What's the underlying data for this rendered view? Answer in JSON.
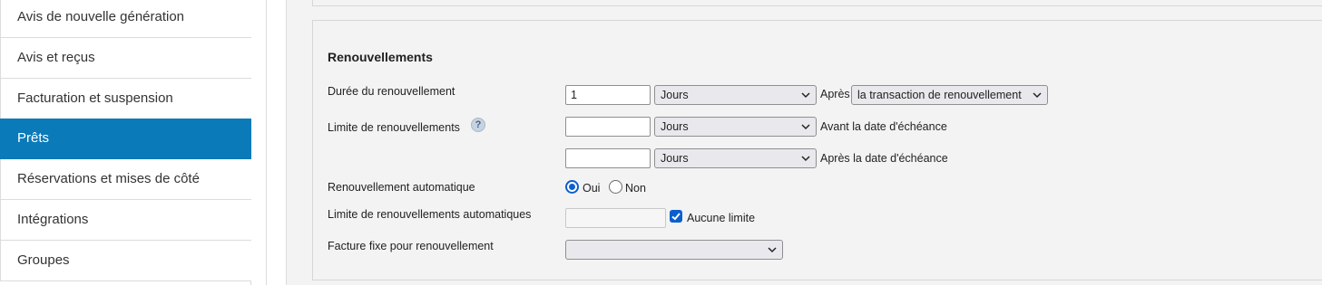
{
  "sidebar": {
    "items": [
      {
        "label": "Avis de nouvelle génération",
        "active": false
      },
      {
        "label": "Avis et reçus",
        "active": false
      },
      {
        "label": "Facturation et suspension",
        "active": false
      },
      {
        "label": "Prêts",
        "active": true
      },
      {
        "label": "Réservations et mises de côté",
        "active": false
      },
      {
        "label": "Intégrations",
        "active": false
      },
      {
        "label": "Groupes",
        "active": false
      }
    ]
  },
  "renewals": {
    "title": "Renouvellements",
    "duration": {
      "label": "Durée du renouvellement",
      "value": "1",
      "unit": "Jours",
      "after_label": "Après",
      "reference": "la transaction de renouvellement"
    },
    "limit": {
      "label": "Limite de renouvellements",
      "help_icon_text": "?",
      "before": {
        "value": "",
        "unit": "Jours",
        "suffix": "Avant la date d'échéance"
      },
      "after": {
        "value": "",
        "unit": "Jours",
        "suffix": "Après la date d'échéance"
      }
    },
    "auto": {
      "label": "Renouvellement automatique",
      "options": [
        "Oui",
        "Non"
      ],
      "selected": "Oui"
    },
    "auto_limit": {
      "label": "Limite de renouvellements automatiques",
      "value": "",
      "no_limit_label": "Aucune limite",
      "no_limit_checked": true
    },
    "fixed_invoice": {
      "label": "Facture fixe pour renouvellement",
      "selected": ""
    }
  },
  "colors": {
    "accent": "#0b7ab8",
    "control_blue": "#0b5fce",
    "panel_bg": "#f3f3f3"
  }
}
